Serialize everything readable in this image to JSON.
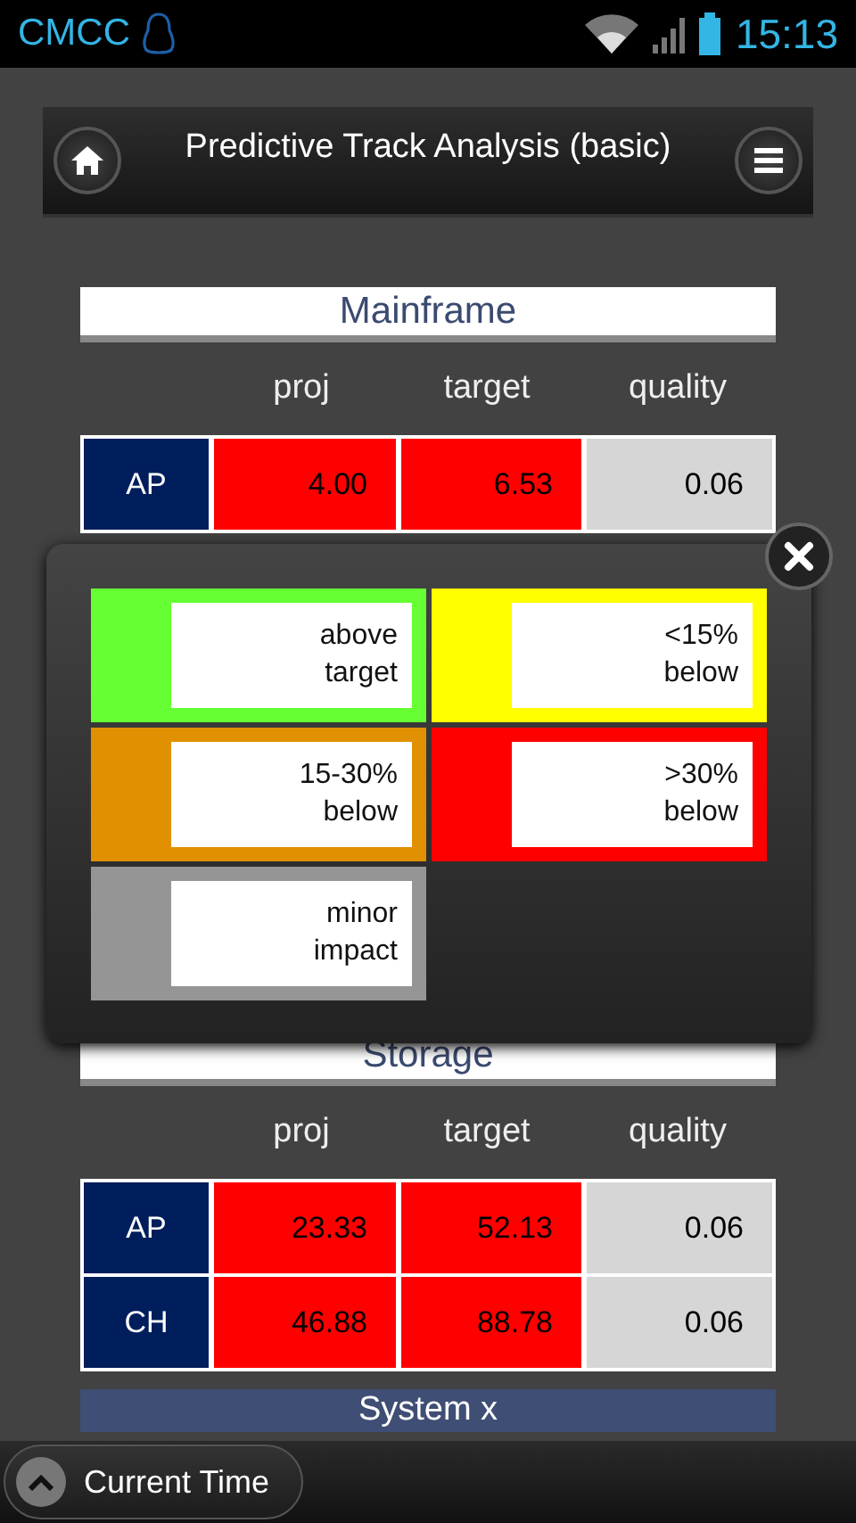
{
  "status_bar": {
    "carrier": "CMCC",
    "time": "15:13"
  },
  "header": {
    "title": "Predictive Track Analysis (basic)"
  },
  "sections": [
    {
      "title": "Mainframe",
      "columns": [
        "proj",
        "target",
        "quality"
      ],
      "rows": [
        {
          "label": "AP",
          "cells": [
            {
              "text": "4.00",
              "color": "#ff0000"
            },
            {
              "text": "6.53",
              "color": "#ff0000"
            },
            {
              "text": "0.06",
              "color": "#d6d6d6"
            }
          ]
        }
      ]
    },
    {
      "title": "Storage",
      "columns": [
        "proj",
        "target",
        "quality"
      ],
      "rows": [
        {
          "label": "AP",
          "cells": [
            {
              "text": "23.33",
              "color": "#ff0000"
            },
            {
              "text": "52.13",
              "color": "#ff0000"
            },
            {
              "text": "0.06",
              "color": "#d6d6d6"
            }
          ]
        },
        {
          "label": "CH",
          "cells": [
            {
              "text": "46.88",
              "color": "#ff0000"
            },
            {
              "text": "88.78",
              "color": "#ff0000"
            },
            {
              "text": "0.06",
              "color": "#d6d6d6"
            }
          ]
        }
      ]
    },
    {
      "title": "System x",
      "kind": "bar"
    }
  ],
  "legend_popup": {
    "items": [
      {
        "text": "above target",
        "color": "#66ff33"
      },
      {
        "text": "<15% below",
        "color": "#ffff00"
      },
      {
        "text": "15-30% below",
        "color": "#e09000"
      },
      {
        "text": ">30% below",
        "color": "#ff0000"
      },
      {
        "text": "minor impact",
        "color": "#959595"
      }
    ]
  },
  "footer": {
    "button": "Current Time"
  }
}
